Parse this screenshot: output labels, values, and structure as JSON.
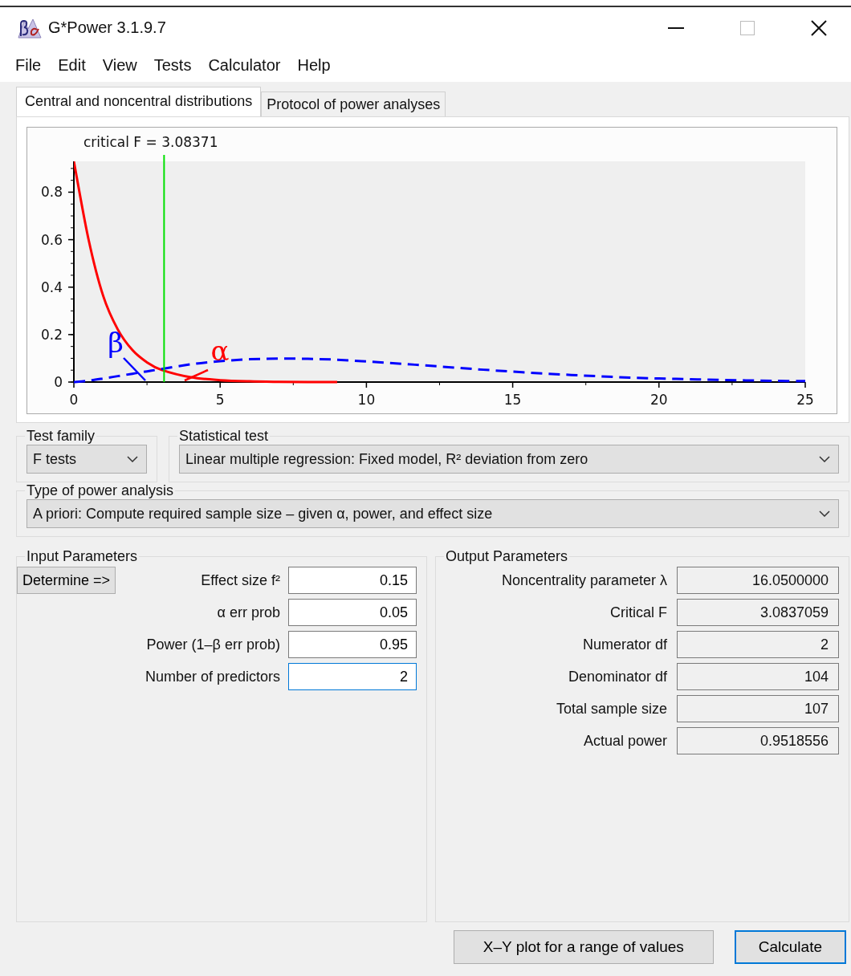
{
  "window": {
    "title": "G*Power 3.1.9.7"
  },
  "menu": [
    "File",
    "Edit",
    "View",
    "Tests",
    "Calculator",
    "Help"
  ],
  "tabs": [
    {
      "label": "Central and noncentral distributions",
      "selected": true
    },
    {
      "label": "Protocol of power analyses",
      "selected": false
    }
  ],
  "chart_data": {
    "type": "line",
    "x": [
      0,
      0.5,
      1,
      1.5,
      2,
      2.5,
      3,
      4,
      5,
      6,
      7,
      8,
      9,
      10,
      11,
      12,
      13,
      14,
      15,
      16,
      17,
      18,
      19,
      20,
      21,
      22,
      23,
      24,
      25
    ],
    "series": [
      {
        "color": "#ff0000",
        "line_style": "solid",
        "values": [
          0.93,
          0.602,
          0.364,
          0.222,
          0.135,
          0.083,
          0.051,
          0.02,
          0.008,
          0.003,
          0.001,
          0,
          0,
          null,
          null,
          null,
          null,
          null,
          null,
          null,
          null,
          null,
          null,
          null,
          null,
          null,
          null,
          null,
          null
        ]
      },
      {
        "color": "#0000ff",
        "line_style": "dashed",
        "values": [
          0,
          0.006,
          0.015,
          0.025,
          0.035,
          0.045,
          0.055,
          0.075,
          0.088,
          0.096,
          0.099,
          0.098,
          0.094,
          0.087,
          0.079,
          0.07,
          0.061,
          0.052,
          0.044,
          0.036,
          0.03,
          0.024,
          0.019,
          0.015,
          0.012,
          0.009,
          0.007,
          0.005,
          0.004
        ]
      }
    ],
    "xlim": [
      0,
      25
    ],
    "ylim": [
      0,
      0.93
    ],
    "xticks": [
      0,
      5,
      10,
      15,
      20,
      25
    ],
    "yticks": [
      {
        "value": 0,
        "label": "0"
      },
      {
        "value": 0.2,
        "label": "0.2"
      },
      {
        "value": 0.4,
        "label": "0.4"
      },
      {
        "value": 0.6,
        "label": "0.6"
      },
      {
        "value": 0.8,
        "label": "0.8"
      }
    ],
    "ref_lines": [
      {
        "axis": "x",
        "value": 3.08371,
        "color": "#00e000"
      }
    ]
  },
  "critical_f_label": "critical F =  3.08371",
  "error_labels": [
    {
      "text": "β",
      "color": "#0000ff"
    },
    {
      "text": "α",
      "color": "#ff0000"
    }
  ],
  "test_family": {
    "label": "Test family",
    "value": "F tests"
  },
  "statistical_test": {
    "label": "Statistical test",
    "value": "Linear multiple regression: Fixed model, R² deviation from zero"
  },
  "power_analysis_type": {
    "label": "Type of power analysis",
    "value": "A priori: Compute required sample size – given α, power, and effect size"
  },
  "input_parameters": {
    "title": "Input Parameters",
    "determine_button": "Determine =>",
    "fields": [
      {
        "label": "Effect size f²",
        "value": "0.15",
        "focused": false
      },
      {
        "label": "α err prob",
        "value": "0.05",
        "focused": false
      },
      {
        "label": "Power (1–β err prob)",
        "value": "0.95",
        "focused": false
      },
      {
        "label": "Number of predictors",
        "value": "2",
        "focused": true
      }
    ]
  },
  "output_parameters": {
    "title": "Output Parameters",
    "fields": [
      {
        "label": "Noncentrality parameter λ",
        "value": "16.0500000"
      },
      {
        "label": "Critical F",
        "value": "3.0837059"
      },
      {
        "label": "Numerator df",
        "value": "2"
      },
      {
        "label": "Denominator df",
        "value": "104"
      },
      {
        "label": "Total sample size",
        "value": "107"
      },
      {
        "label": "Actual power",
        "value": "0.9518556"
      }
    ]
  },
  "buttons": [
    {
      "label": "X–Y plot for a range of values",
      "focused": false
    },
    {
      "label": "Calculate",
      "focused": true
    }
  ]
}
